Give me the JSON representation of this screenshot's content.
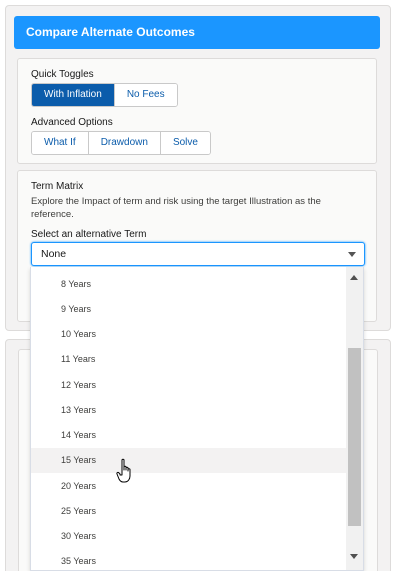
{
  "header": {
    "title": "Compare Alternate Outcomes"
  },
  "quick_toggles": {
    "label": "Quick Toggles",
    "buttons": [
      {
        "label": "With Inflation",
        "active": true
      },
      {
        "label": "No Fees",
        "active": false
      }
    ]
  },
  "advanced_options": {
    "label": "Advanced Options",
    "buttons": [
      {
        "label": "What If"
      },
      {
        "label": "Drawdown"
      },
      {
        "label": "Solve"
      }
    ]
  },
  "term_matrix": {
    "title": "Term Matrix",
    "description": "Explore the Impact of term and risk using the target Illustration as the reference.",
    "select_label": "Select an alternative Term",
    "selected_value": "None"
  },
  "dropdown": {
    "options": [
      "8 Years",
      "9 Years",
      "10 Years",
      "11 Years",
      "12 Years",
      "13 Years",
      "14 Years",
      "15 Years",
      "20 Years",
      "25 Years",
      "30 Years",
      "35 Years"
    ],
    "hovered": "15 Years"
  },
  "colors": {
    "header_bg": "#1b96ff",
    "active_button_bg": "#0b5cab",
    "button_text": "#0b5cab"
  },
  "icons": [
    "chevron-down-icon",
    "scroll-up-arrow-icon",
    "scroll-down-arrow-icon",
    "hand-pointer-cursor-icon"
  ]
}
